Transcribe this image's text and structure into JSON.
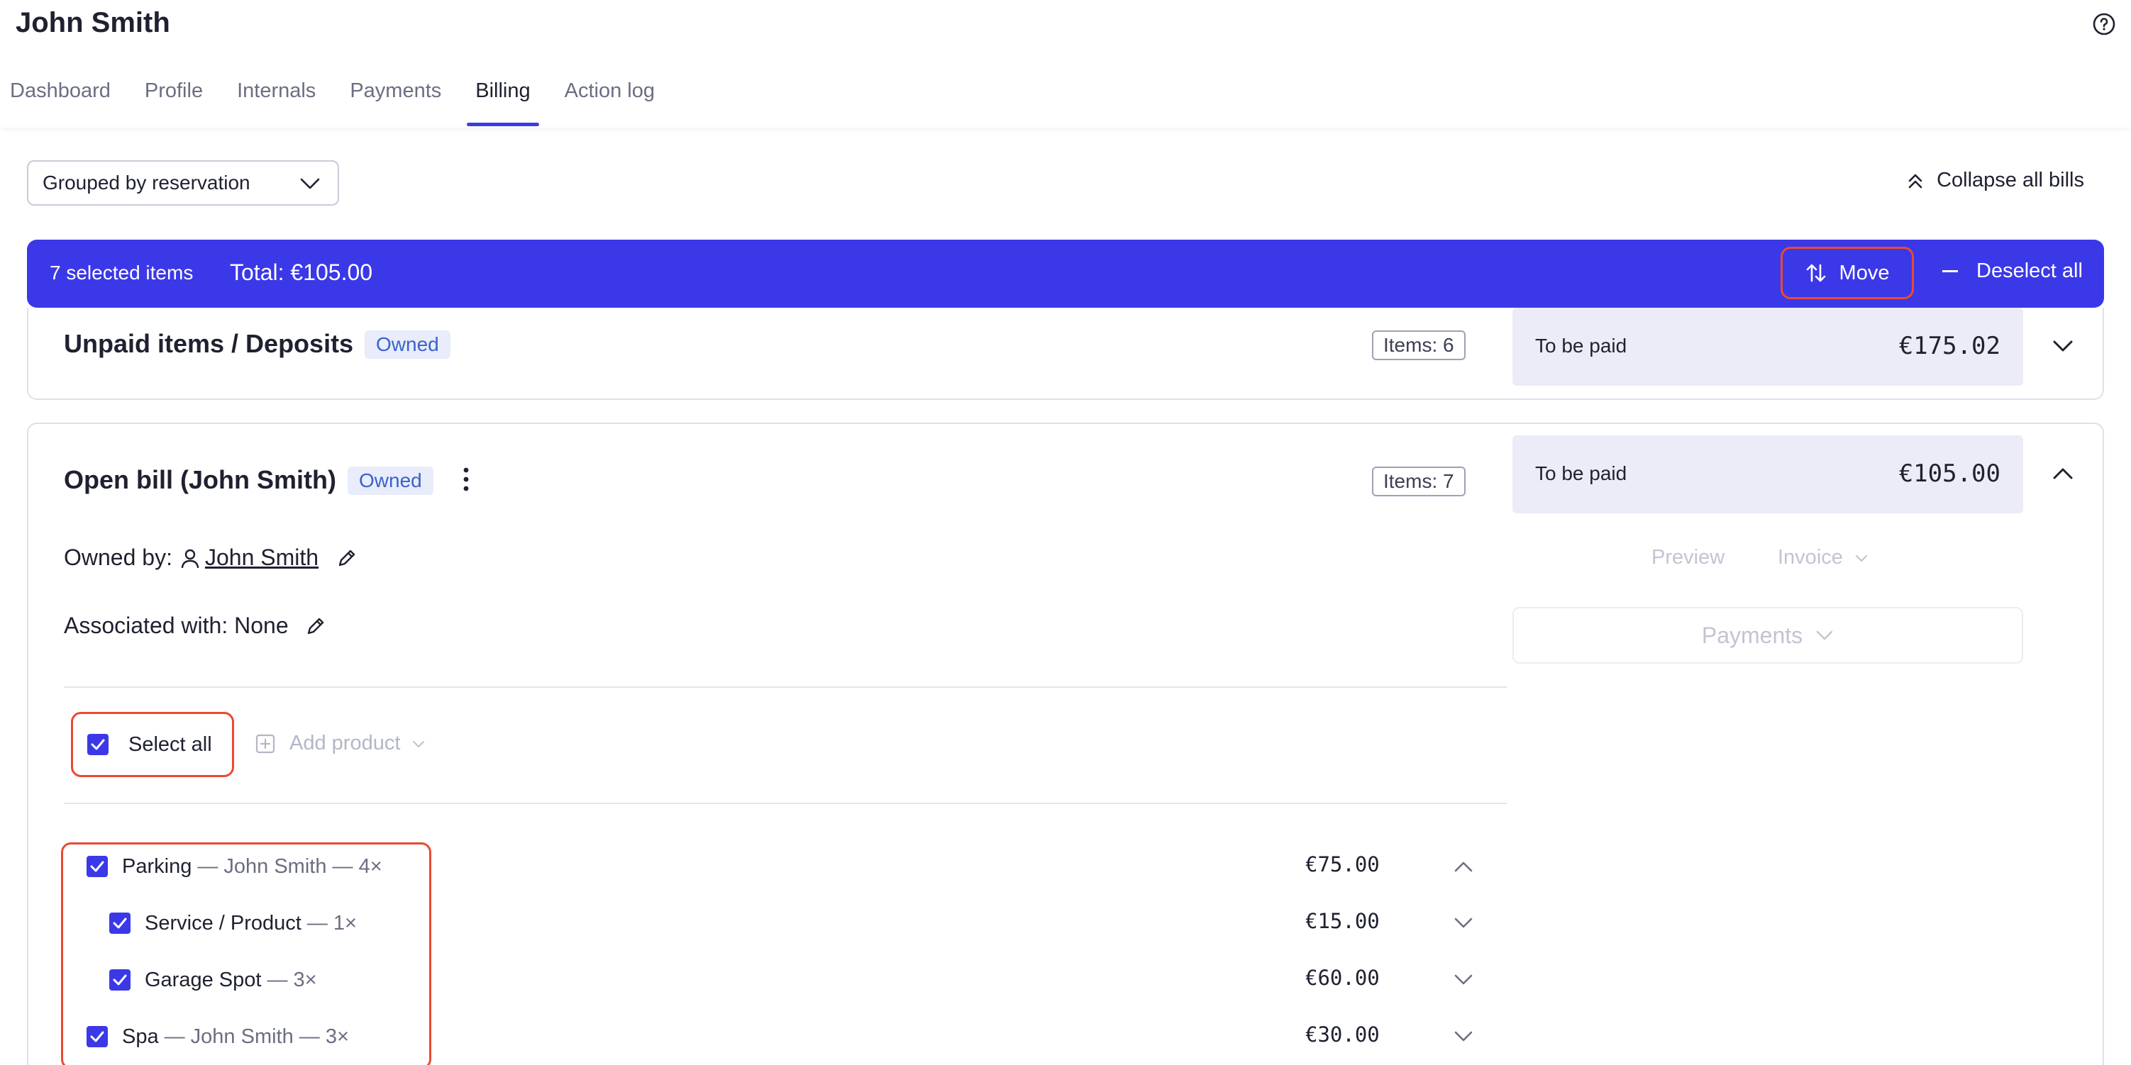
{
  "header": {
    "title": "John Smith",
    "tabs": [
      {
        "label": "Dashboard"
      },
      {
        "label": "Profile"
      },
      {
        "label": "Internals"
      },
      {
        "label": "Payments"
      },
      {
        "label": "Billing",
        "active": true
      },
      {
        "label": "Action log"
      }
    ]
  },
  "toolbar": {
    "grouping_value": "Grouped by reservation",
    "collapse_label": "Collapse all bills"
  },
  "selection_bar": {
    "count_label": "7 selected items",
    "total_label": "Total: €105.00",
    "move_label": "Move",
    "deselect_label": "Deselect all",
    "color": "#3b38e8"
  },
  "bills": [
    {
      "title": "Unpaid items / Deposits",
      "badge": "Owned",
      "items_count": "Items: 6",
      "pay_label": "To be paid",
      "pay_amount": "€175.02"
    },
    {
      "title": "Open bill (John Smith)",
      "badge": "Owned",
      "items_count": "Items: 7",
      "pay_label": "To be paid",
      "pay_amount": "€105.00",
      "owned_by_label": "Owned by:",
      "owner_name": "John Smith",
      "associated_label": "Associated with: None",
      "select_all_label": "Select all",
      "add_product_label": "Add product",
      "preview_label": "Preview",
      "invoice_label": "Invoice",
      "payments_label": "Payments",
      "items": [
        {
          "name": "Parking",
          "meta": "— John Smith — 4×",
          "price": "€75.00"
        },
        {
          "name": "Service / Product",
          "meta": "— 1×",
          "price": "€15.00"
        },
        {
          "name": "Garage Spot",
          "meta": "— 3×",
          "price": "€60.00"
        },
        {
          "name": "Spa",
          "meta": "— John Smith — 3×",
          "price": "€30.00"
        }
      ]
    }
  ]
}
